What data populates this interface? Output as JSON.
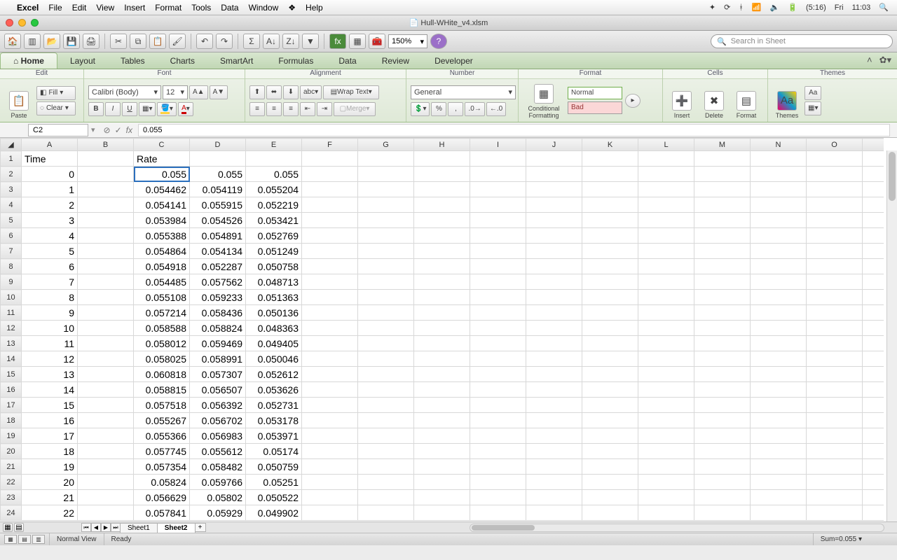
{
  "mac_menu": {
    "app": "Excel",
    "items": [
      "File",
      "Edit",
      "View",
      "Insert",
      "Format",
      "Tools",
      "Data",
      "Window",
      "Help"
    ],
    "battery": "(5:16)",
    "day": "Fri",
    "time": "11:03"
  },
  "window": {
    "title": "Hull-WHite_v4.xlsm"
  },
  "quick_toolbar": {
    "zoom": "150%",
    "search_placeholder": "Search in Sheet"
  },
  "ribbon": {
    "tabs": [
      "Home",
      "Layout",
      "Tables",
      "Charts",
      "SmartArt",
      "Formulas",
      "Data",
      "Review",
      "Developer"
    ],
    "active_tab": "Home",
    "groups": {
      "edit": {
        "label": "Edit",
        "paste": "Paste",
        "fill": "Fill",
        "clear": "Clear"
      },
      "font": {
        "label": "Font",
        "name": "Calibri (Body)",
        "size": "12"
      },
      "align": {
        "label": "Alignment",
        "wrap": "Wrap Text",
        "merge": "Merge"
      },
      "number": {
        "label": "Number",
        "format": "General"
      },
      "format": {
        "label": "Format",
        "cond": "Conditional Formatting",
        "style_normal": "Normal",
        "style_bad": "Bad"
      },
      "cells": {
        "label": "Cells",
        "insert": "Insert",
        "delete": "Delete",
        "format": "Format"
      },
      "themes": {
        "label": "Themes",
        "themes": "Themes",
        "aa": "Aa"
      }
    }
  },
  "formula_bar": {
    "name_box": "C2",
    "formula": "0.055"
  },
  "grid": {
    "columns": [
      "A",
      "B",
      "C",
      "D",
      "E",
      "F",
      "G",
      "H",
      "I",
      "J",
      "K",
      "L",
      "M",
      "N",
      "O"
    ],
    "selected_cell": "C2",
    "rows": [
      {
        "r": 1,
        "A": "Time",
        "C": "Rate"
      },
      {
        "r": 2,
        "A": "0",
        "C": "0.055",
        "D": "0.055",
        "E": "0.055"
      },
      {
        "r": 3,
        "A": "1",
        "C": "0.054462",
        "D": "0.054119",
        "E": "0.055204"
      },
      {
        "r": 4,
        "A": "2",
        "C": "0.054141",
        "D": "0.055915",
        "E": "0.052219"
      },
      {
        "r": 5,
        "A": "3",
        "C": "0.053984",
        "D": "0.054526",
        "E": "0.053421"
      },
      {
        "r": 6,
        "A": "4",
        "C": "0.055388",
        "D": "0.054891",
        "E": "0.052769"
      },
      {
        "r": 7,
        "A": "5",
        "C": "0.054864",
        "D": "0.054134",
        "E": "0.051249"
      },
      {
        "r": 8,
        "A": "6",
        "C": "0.054918",
        "D": "0.052287",
        "E": "0.050758"
      },
      {
        "r": 9,
        "A": "7",
        "C": "0.054485",
        "D": "0.057562",
        "E": "0.048713"
      },
      {
        "r": 10,
        "A": "8",
        "C": "0.055108",
        "D": "0.059233",
        "E": "0.051363"
      },
      {
        "r": 11,
        "A": "9",
        "C": "0.057214",
        "D": "0.058436",
        "E": "0.050136"
      },
      {
        "r": 12,
        "A": "10",
        "C": "0.058588",
        "D": "0.058824",
        "E": "0.048363"
      },
      {
        "r": 13,
        "A": "11",
        "C": "0.058012",
        "D": "0.059469",
        "E": "0.049405"
      },
      {
        "r": 14,
        "A": "12",
        "C": "0.058025",
        "D": "0.058991",
        "E": "0.050046"
      },
      {
        "r": 15,
        "A": "13",
        "C": "0.060818",
        "D": "0.057307",
        "E": "0.052612"
      },
      {
        "r": 16,
        "A": "14",
        "C": "0.058815",
        "D": "0.056507",
        "E": "0.053626"
      },
      {
        "r": 17,
        "A": "15",
        "C": "0.057518",
        "D": "0.056392",
        "E": "0.052731"
      },
      {
        "r": 18,
        "A": "16",
        "C": "0.055267",
        "D": "0.056702",
        "E": "0.053178"
      },
      {
        "r": 19,
        "A": "17",
        "C": "0.055366",
        "D": "0.056983",
        "E": "0.053971"
      },
      {
        "r": 20,
        "A": "18",
        "C": "0.057745",
        "D": "0.055612",
        "E": "0.05174"
      },
      {
        "r": 21,
        "A": "19",
        "C": "0.057354",
        "D": "0.058482",
        "E": "0.050759"
      },
      {
        "r": 22,
        "A": "20",
        "C": "0.05824",
        "D": "0.059766",
        "E": "0.05251"
      },
      {
        "r": 23,
        "A": "21",
        "C": "0.056629",
        "D": "0.05802",
        "E": "0.050522"
      },
      {
        "r": 24,
        "A": "22",
        "C": "0.057841",
        "D": "0.05929",
        "E": "0.049902"
      }
    ]
  },
  "sheets": {
    "tabs": [
      "Sheet1",
      "Sheet2"
    ],
    "active": "Sheet2"
  },
  "status": {
    "view": "Normal View",
    "state": "Ready",
    "sum": "Sum=0.055"
  }
}
